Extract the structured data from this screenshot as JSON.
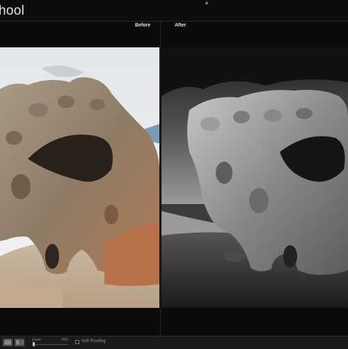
{
  "header": {
    "title": "hool"
  },
  "compare": {
    "before_label": "Before",
    "after_label": "After"
  },
  "toolbar": {
    "zoom_label": "Zoom",
    "zoom_value": "25%",
    "soft_proofing_label": "Soft Proofing",
    "soft_proofing_checked": false
  },
  "icons": {
    "collapse": "collapse-arrow-icon",
    "view_single": "loupe-view-icon",
    "view_compare": "before-after-view-icon"
  },
  "colors": {
    "background": "#0b0b0b",
    "divider": "#262626",
    "bottombar": "#1a1a1a"
  }
}
